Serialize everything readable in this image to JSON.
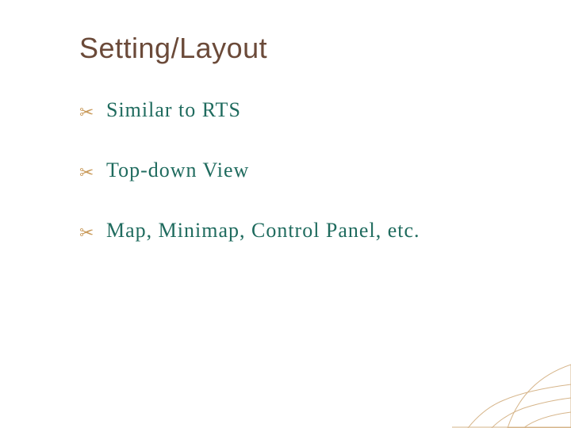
{
  "title": "Setting/Layout",
  "bullets": [
    "Similar to RTS",
    "Top-down View",
    "Map, Minimap, Control Panel, etc."
  ],
  "colors": {
    "title": "#6b4a39",
    "bullet_text": "#1f6b5e",
    "bullet_marker": "#c99a5a",
    "corner_art": "#c9a268"
  }
}
